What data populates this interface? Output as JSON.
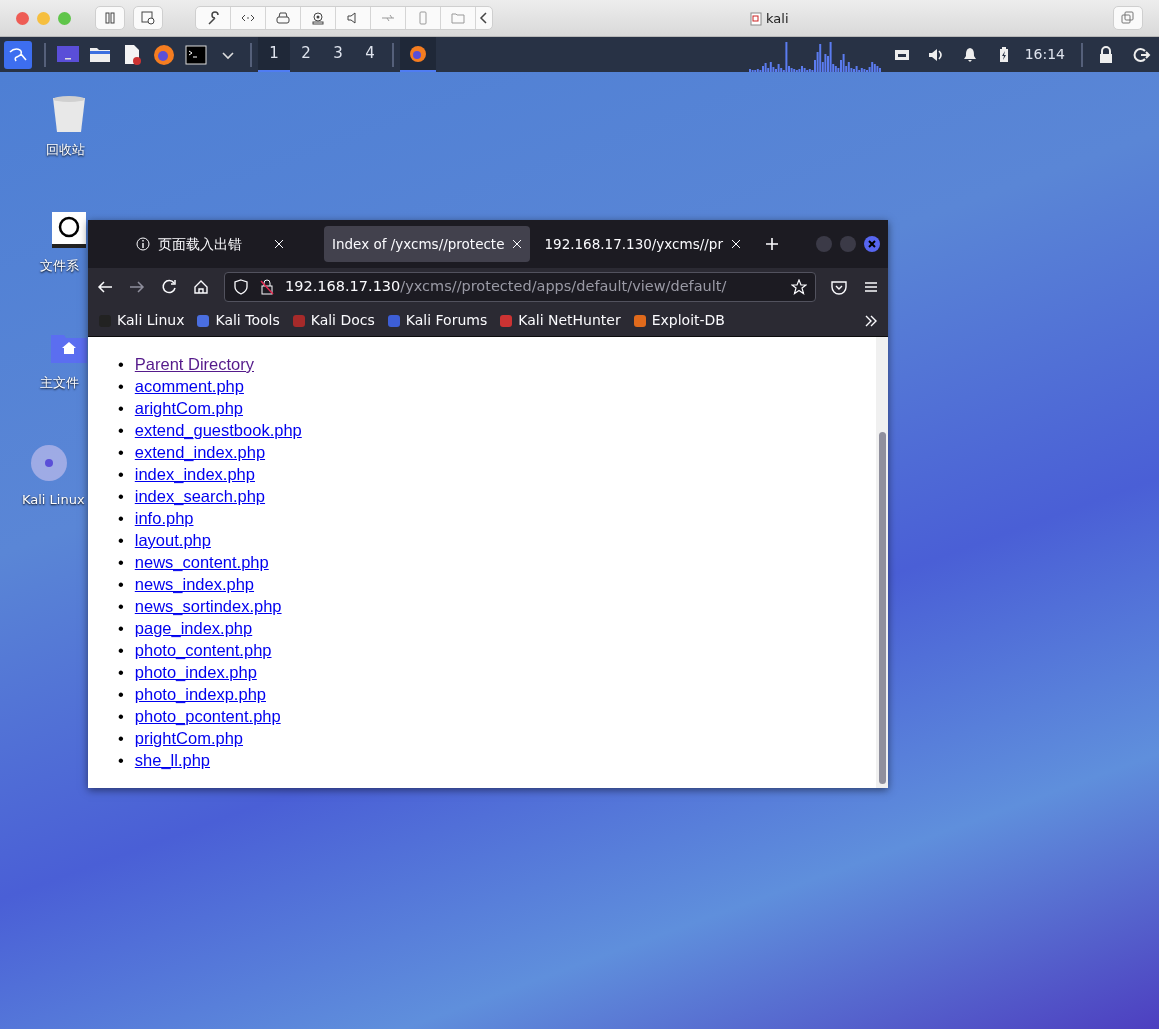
{
  "host_window": {
    "title": "kali"
  },
  "panel": {
    "workspaces": [
      {
        "label": "1",
        "selected": true
      },
      {
        "label": "2",
        "selected": false
      },
      {
        "label": "3",
        "selected": false
      },
      {
        "label": "4",
        "selected": false
      }
    ],
    "clock": "16:14"
  },
  "desktop_icons": [
    {
      "label": "回收站",
      "kind": "trash"
    },
    {
      "label": "文件系",
      "kind": "drive"
    },
    {
      "label": "主文件",
      "kind": "home"
    },
    {
      "label": "Kali Linux",
      "kind": "disc"
    }
  ],
  "browser": {
    "tabs": [
      {
        "title": "页面载入出错",
        "kind": "error",
        "selected": false
      },
      {
        "title": "Index of /yxcms//protecte",
        "kind": "page",
        "selected": true
      },
      {
        "title": "192.168.17.130/yxcms//pr",
        "kind": "page",
        "selected": false
      }
    ],
    "url_host": "192.168.17.130",
    "url_path": "/yxcms//protected/apps/default/view/default/",
    "bookmarks": [
      {
        "label": "Kali Linux"
      },
      {
        "label": "Kali Tools"
      },
      {
        "label": "Kali Docs"
      },
      {
        "label": "Kali Forums"
      },
      {
        "label": "Kali NetHunter"
      },
      {
        "label": "Exploit-DB"
      }
    ],
    "links": [
      {
        "bullet": "•",
        "text": "Parent Directory",
        "visited": true
      },
      {
        "bullet": "•",
        "text": "acomment.php",
        "visited": false
      },
      {
        "bullet": "•",
        "text": "arightCom.php",
        "visited": false
      },
      {
        "bullet": "•",
        "text": "extend_guestbook.php",
        "visited": false
      },
      {
        "bullet": "•",
        "text": "extend_index.php",
        "visited": false
      },
      {
        "bullet": "•",
        "text": "index_index.php",
        "visited": false
      },
      {
        "bullet": "•",
        "text": "index_search.php",
        "visited": false
      },
      {
        "bullet": "•",
        "text": "info.php",
        "visited": false
      },
      {
        "bullet": "•",
        "text": "layout.php",
        "visited": false
      },
      {
        "bullet": "•",
        "text": "news_content.php",
        "visited": false
      },
      {
        "bullet": "•",
        "text": "news_index.php",
        "visited": false
      },
      {
        "bullet": "•",
        "text": "news_sortindex.php",
        "visited": false
      },
      {
        "bullet": "•",
        "text": "page_index.php",
        "visited": false
      },
      {
        "bullet": "•",
        "text": "photo_content.php",
        "visited": false
      },
      {
        "bullet": "•",
        "text": "photo_index.php",
        "visited": false
      },
      {
        "bullet": "•",
        "text": "photo_indexp.php",
        "visited": false
      },
      {
        "bullet": "•",
        "text": "photo_pcontent.php",
        "visited": false
      },
      {
        "bullet": "•",
        "text": "prightCom.php",
        "visited": false
      },
      {
        "bullet": "•",
        "text": "she_ll.php",
        "visited": false
      }
    ]
  }
}
